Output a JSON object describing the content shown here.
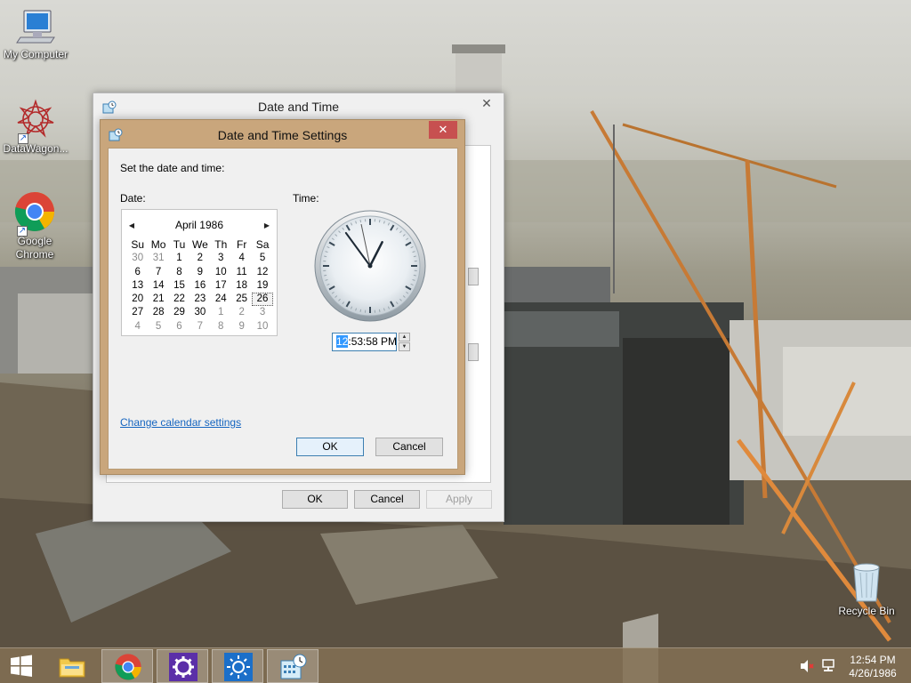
{
  "desktop": {
    "icons": [
      {
        "label": "My Computer"
      },
      {
        "label": "DataWagon..."
      },
      {
        "label": "Google Chrome"
      },
      {
        "label": "Recycle Bin"
      }
    ]
  },
  "outer_window": {
    "title": "Date and Time",
    "buttons": {
      "ok": "OK",
      "cancel": "Cancel",
      "apply": "Apply"
    }
  },
  "dialog": {
    "title": "Date and Time Settings",
    "instruction": "Set the date and time:",
    "date_label": "Date:",
    "time_label": "Time:",
    "calendar": {
      "month_year": "April 1986",
      "day_headers": [
        "Su",
        "Mo",
        "Tu",
        "We",
        "Th",
        "Fr",
        "Sa"
      ],
      "weeks": [
        [
          "30",
          "31",
          "1",
          "2",
          "3",
          "4",
          "5"
        ],
        [
          "6",
          "7",
          "8",
          "9",
          "10",
          "11",
          "12"
        ],
        [
          "13",
          "14",
          "15",
          "16",
          "17",
          "18",
          "19"
        ],
        [
          "20",
          "21",
          "22",
          "23",
          "24",
          "25",
          "26"
        ],
        [
          "27",
          "28",
          "29",
          "30",
          "1",
          "2",
          "3"
        ],
        [
          "4",
          "5",
          "6",
          "7",
          "8",
          "9",
          "10"
        ]
      ],
      "selected_day": "26"
    },
    "clock": {
      "hour": 12,
      "minute": 53,
      "second": 58
    },
    "time_value": {
      "selected_part": "12",
      "rest": ":53:58 PM"
    },
    "change_calendar_link": "Change calendar settings",
    "buttons": {
      "ok": "OK",
      "cancel": "Cancel"
    }
  },
  "taskbar": {
    "apps": [
      "file-explorer",
      "google-chrome",
      "settings",
      "display-brightness",
      "date-and-time"
    ],
    "tray": {
      "time": "12:54 PM",
      "date": "4/26/1986"
    }
  }
}
